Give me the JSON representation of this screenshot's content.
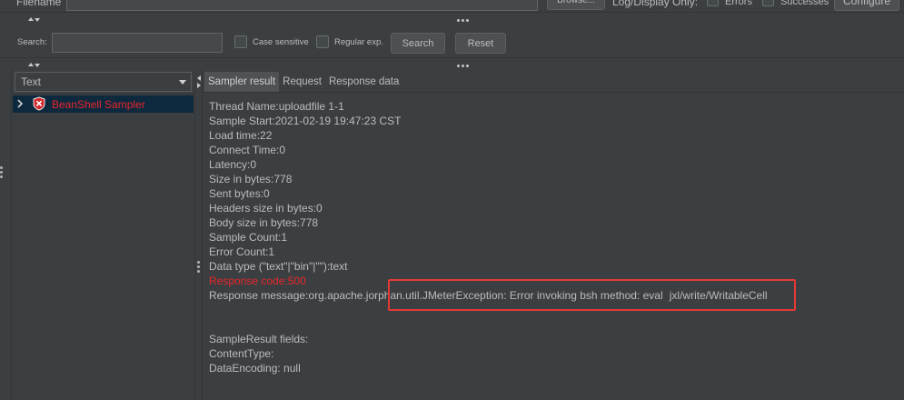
{
  "top_bar": {
    "filename_label": "Filename",
    "filename_value": "",
    "browse_button": "Browse...",
    "log_display_label": "Log/Display Only:",
    "errors_label": "Errors",
    "errors_checked": false,
    "successes_label": "Successes",
    "successes_checked": false,
    "configure_button": "Configure"
  },
  "search": {
    "label": "Search:",
    "value": "",
    "case_sensitive_label": "Case sensitive",
    "case_sensitive_checked": false,
    "regex_label": "Regular exp.",
    "regex_checked": false,
    "search_button": "Search",
    "reset_button": "Reset"
  },
  "results_panel": {
    "renderer": "Text",
    "tree": [
      {
        "label": "BeanShell Sampler",
        "failed": true,
        "selected": true,
        "expandable": true,
        "icon": "error-shield-icon"
      }
    ]
  },
  "tabs": [
    {
      "label": "Sampler result",
      "selected": true
    },
    {
      "label": "Request",
      "selected": false
    },
    {
      "label": "Response data",
      "selected": false
    }
  ],
  "sampler_result": {
    "lines": [
      {
        "text": "Thread Name:uploadfile 1-1"
      },
      {
        "text": "Sample Start:2021-02-19 19:47:23 CST"
      },
      {
        "text": "Load time:22"
      },
      {
        "text": "Connect Time:0"
      },
      {
        "text": "Latency:0"
      },
      {
        "text": "Size in bytes:778"
      },
      {
        "text": "Sent bytes:0"
      },
      {
        "text": "Headers size in bytes:0"
      },
      {
        "text": "Body size in bytes:778"
      },
      {
        "text": "Sample Count:1"
      },
      {
        "text": "Error Count:1"
      },
      {
        "text": "Data type (\"text\"|\"bin\"|\"\"):text"
      },
      {
        "text": "Response code:500",
        "error": true
      },
      {
        "text": "Response message:org.apache.jorphan.util.JMeterException: Error invoking bsh method: eval\tjxl/write/WritableCell"
      }
    ],
    "fields": [
      "SampleResult fields:",
      "ContentType:",
      "DataEncoding: null"
    ]
  },
  "colors": {
    "background": "#3c3f41",
    "text": "#bbbbbb",
    "error_text": "#e8262b",
    "tree_selection": "#0d293e",
    "highlight_box": "#e53935"
  },
  "icons": {
    "tree_expand": "chevron-right-icon",
    "sample_status": "error-shield-icon",
    "renderer_dropdown": "chevron-down-icon"
  }
}
